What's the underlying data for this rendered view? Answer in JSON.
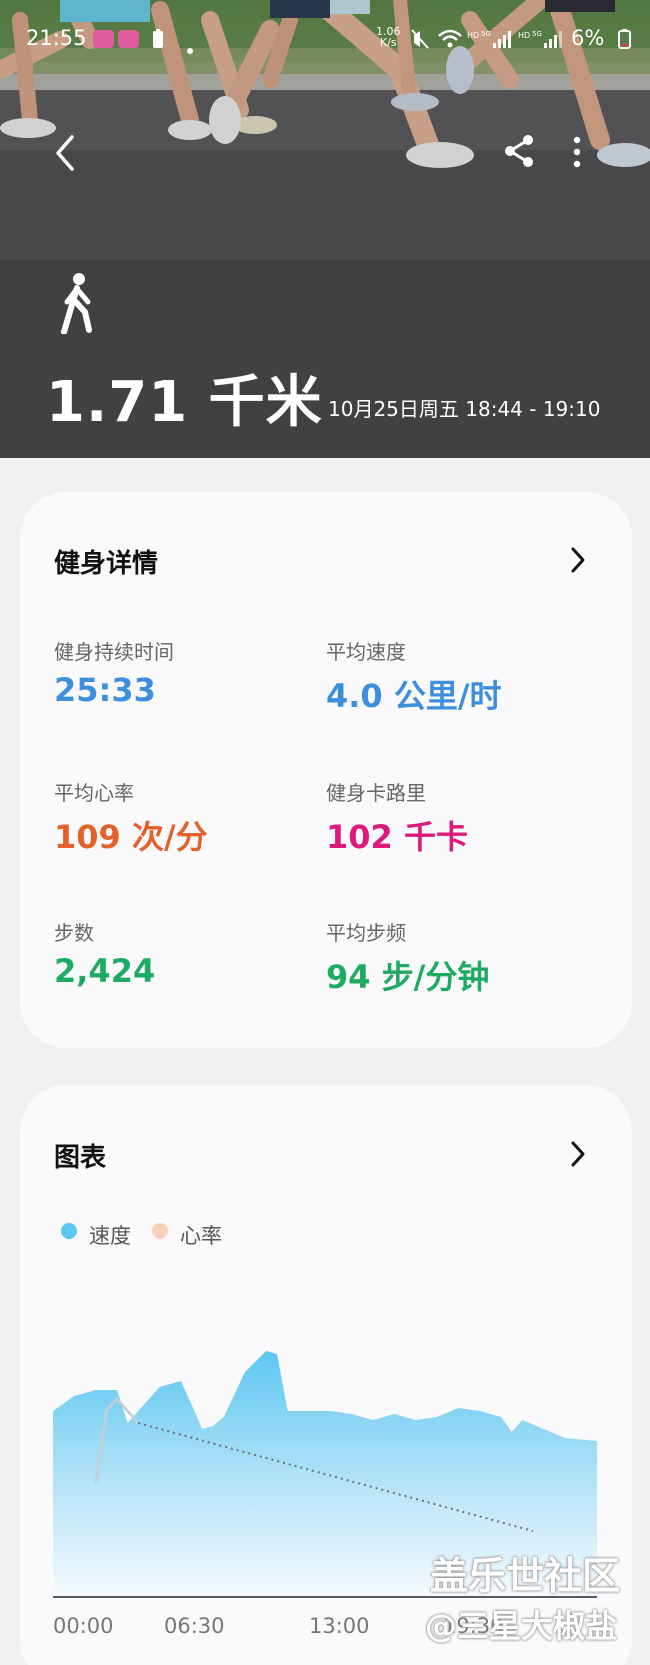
{
  "status_bar": {
    "time": "21:55",
    "net_speed_top": "1.06",
    "net_speed_bottom": "K/s",
    "battery": "6%"
  },
  "hero": {
    "distance": "1.71 千米",
    "time_range": "10月25日周五 18:44 - 19:10",
    "icons": [
      "back-icon",
      "share-icon",
      "more-icon",
      "walk-icon"
    ]
  },
  "details": {
    "title": "健身详情",
    "metrics": [
      {
        "label": "健身持续时间",
        "value": "25:33",
        "color": "#3d8fde"
      },
      {
        "label": "平均速度",
        "value": "4.0 公里/时",
        "color": "#3d8fde"
      },
      {
        "label": "平均心率",
        "value": "109 次/分",
        "color": "#e3622b"
      },
      {
        "label": "健身卡路里",
        "value": "102 千卡",
        "color": "#dd1a7b"
      },
      {
        "label": "步数",
        "value": "2,424",
        "color": "#1faa61"
      },
      {
        "label": "平均步频",
        "value": "94 步/分钟",
        "color": "#1faa61"
      }
    ]
  },
  "chart": {
    "title": "图表",
    "legend": [
      {
        "name": "速度",
        "color": "#5cc7f0"
      },
      {
        "name": "心率",
        "color": "#f9d2bd"
      }
    ],
    "x_ticks": [
      "00:00",
      "06:30",
      "13:00",
      "19:30"
    ]
  },
  "chart_data": {
    "type": "area",
    "xlabel": "",
    "ylabel": "",
    "x_ticks": [
      "00:00",
      "06:30",
      "13:00",
      "19:30"
    ],
    "xlim_minutes": [
      0,
      25.5
    ],
    "series": [
      {
        "name": "速度",
        "style": "area",
        "x_minutes": [
          0,
          1,
          2,
          3,
          3.5,
          4,
          5,
          6,
          7,
          7.5,
          8,
          9,
          10,
          10.5,
          11,
          12,
          13,
          14,
          15,
          16,
          17,
          18,
          19,
          20,
          21,
          21.5,
          22,
          23,
          24,
          25.5
        ],
        "y_relative": [
          0.62,
          0.67,
          0.69,
          0.69,
          0.58,
          0.62,
          0.7,
          0.72,
          0.56,
          0.57,
          0.6,
          0.75,
          0.82,
          0.81,
          0.62,
          0.62,
          0.62,
          0.61,
          0.59,
          0.61,
          0.59,
          0.6,
          0.63,
          0.62,
          0.6,
          0.55,
          0.59,
          0.56,
          0.53,
          0.52
        ]
      },
      {
        "name": "心率",
        "style": "line-with-dotted-trend",
        "x_minutes": [
          2,
          2.5,
          3,
          3.5,
          4
        ],
        "y_relative": [
          0.38,
          0.62,
          0.66,
          0.62,
          0.58
        ],
        "trend_to": {
          "x_minutes": 22.5,
          "y_relative": 0.22
        }
      }
    ],
    "legend_position": "top-left",
    "grid": false
  },
  "watermark": {
    "line1": "盖乐世社区",
    "line2": "@三星大椒盐"
  }
}
